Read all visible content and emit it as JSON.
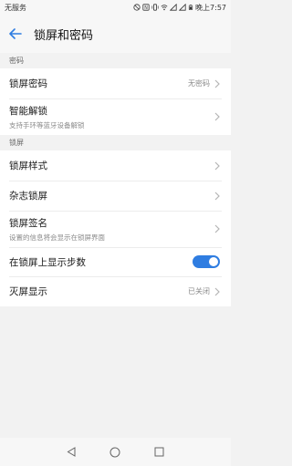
{
  "status_bar": {
    "carrier": "无服务",
    "time_label": "晚上7:57"
  },
  "header": {
    "title": "锁屏和密码"
  },
  "sections": {
    "password": {
      "label": "密码",
      "items": [
        {
          "title": "锁屏密码",
          "value": "无密码"
        },
        {
          "title": "智能解锁",
          "subtitle": "支持手环等蓝牙设备解锁"
        }
      ]
    },
    "lockscreen": {
      "label": "锁屏",
      "items": [
        {
          "title": "锁屏样式"
        },
        {
          "title": "杂志锁屏"
        },
        {
          "title": "锁屏签名",
          "subtitle": "设置的信息将会显示在锁屏界面"
        },
        {
          "title": "在锁屏上显示步数",
          "toggle_on": true
        },
        {
          "title": "灭屏显示",
          "value": "已关闭"
        }
      ]
    }
  },
  "colors": {
    "accent": "#2f7de1",
    "background": "#f2f2f2"
  }
}
